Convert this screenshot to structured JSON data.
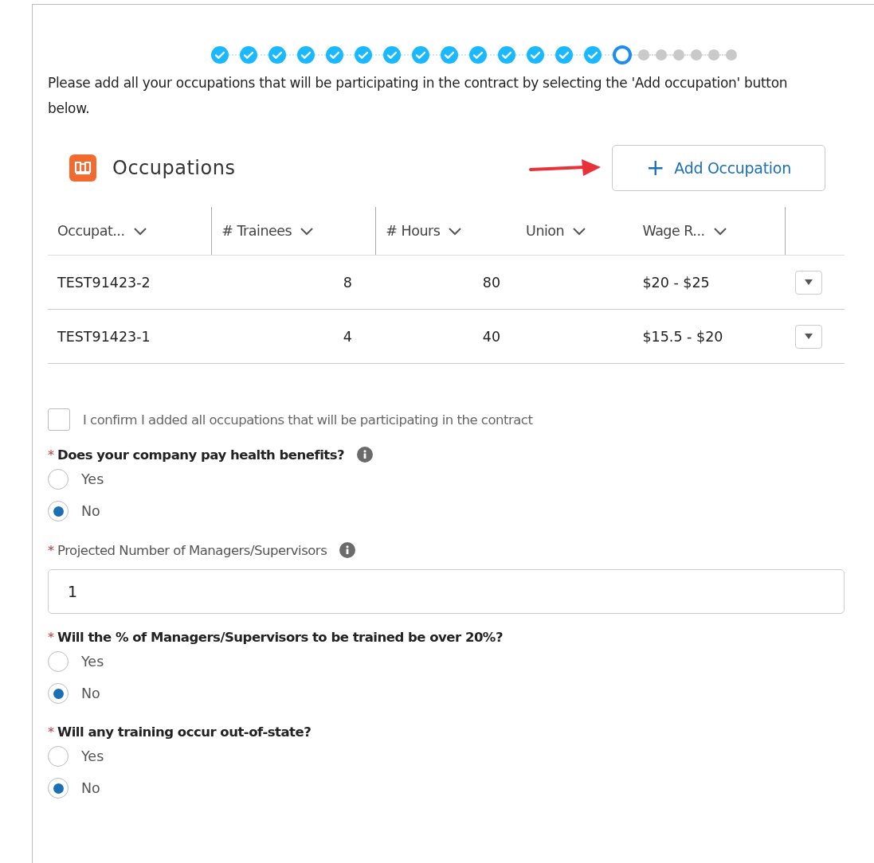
{
  "progress": {
    "steps": [
      {
        "kind": "complete"
      },
      {
        "kind": "complete"
      },
      {
        "kind": "complete"
      },
      {
        "kind": "complete"
      },
      {
        "kind": "complete"
      },
      {
        "kind": "complete"
      },
      {
        "kind": "complete"
      },
      {
        "kind": "complete"
      },
      {
        "kind": "complete"
      },
      {
        "kind": "complete"
      },
      {
        "kind": "complete"
      },
      {
        "kind": "complete"
      },
      {
        "kind": "complete"
      },
      {
        "kind": "complete"
      },
      {
        "kind": "current"
      },
      {
        "kind": "incomplete"
      },
      {
        "kind": "incomplete"
      },
      {
        "kind": "incomplete"
      },
      {
        "kind": "incomplete"
      },
      {
        "kind": "incomplete"
      },
      {
        "kind": "incomplete"
      }
    ]
  },
  "instructions": "Please add all your occupations that will be participating in the contract by selecting the 'Add occupation' button below.",
  "card": {
    "title": "Occupations",
    "add_button": "+",
    "add_label": "Add Occupation",
    "columns": [
      {
        "label": "Occupat...",
        "kind": "text"
      },
      {
        "label": "# Trainees",
        "kind": "number"
      },
      {
        "label": "# Hours",
        "kind": "number"
      },
      {
        "label": "Union",
        "kind": "text"
      },
      {
        "label": "Wage R...",
        "kind": "text"
      }
    ],
    "rows": [
      {
        "cells": [
          "TEST91423-2",
          "8",
          "80",
          "",
          "$20 - $25"
        ]
      },
      {
        "cells": [
          "TEST91423-1",
          "4",
          "40",
          "",
          "$15.5 - $20"
        ]
      }
    ]
  },
  "confirm": {
    "label": "I confirm I added all occupations that will be participating in the contract",
    "checked": false
  },
  "questions": [
    {
      "kind": "radio",
      "required_mark": "*",
      "label": "Does your company pay health benefits?",
      "bold": true,
      "info": true,
      "options": [
        {
          "label": "Yes",
          "selected": false
        },
        {
          "label": "No",
          "selected": true
        }
      ]
    },
    {
      "kind": "number",
      "required_mark": "*",
      "label": "Projected Number of Managers/Supervisors",
      "bold": false,
      "info": true,
      "value": "1"
    },
    {
      "kind": "radio",
      "required_mark": "*",
      "label": "Will the % of Managers/Supervisors to be trained be over 20%?",
      "bold": true,
      "info": false,
      "options": [
        {
          "label": "Yes",
          "selected": false
        },
        {
          "label": "No",
          "selected": true
        }
      ]
    },
    {
      "kind": "radio",
      "required_mark": "*",
      "label": "Will any training occur out-of-state?",
      "bold": true,
      "info": false,
      "options": [
        {
          "label": "Yes",
          "selected": false
        },
        {
          "label": "No",
          "selected": true
        }
      ]
    }
  ]
}
